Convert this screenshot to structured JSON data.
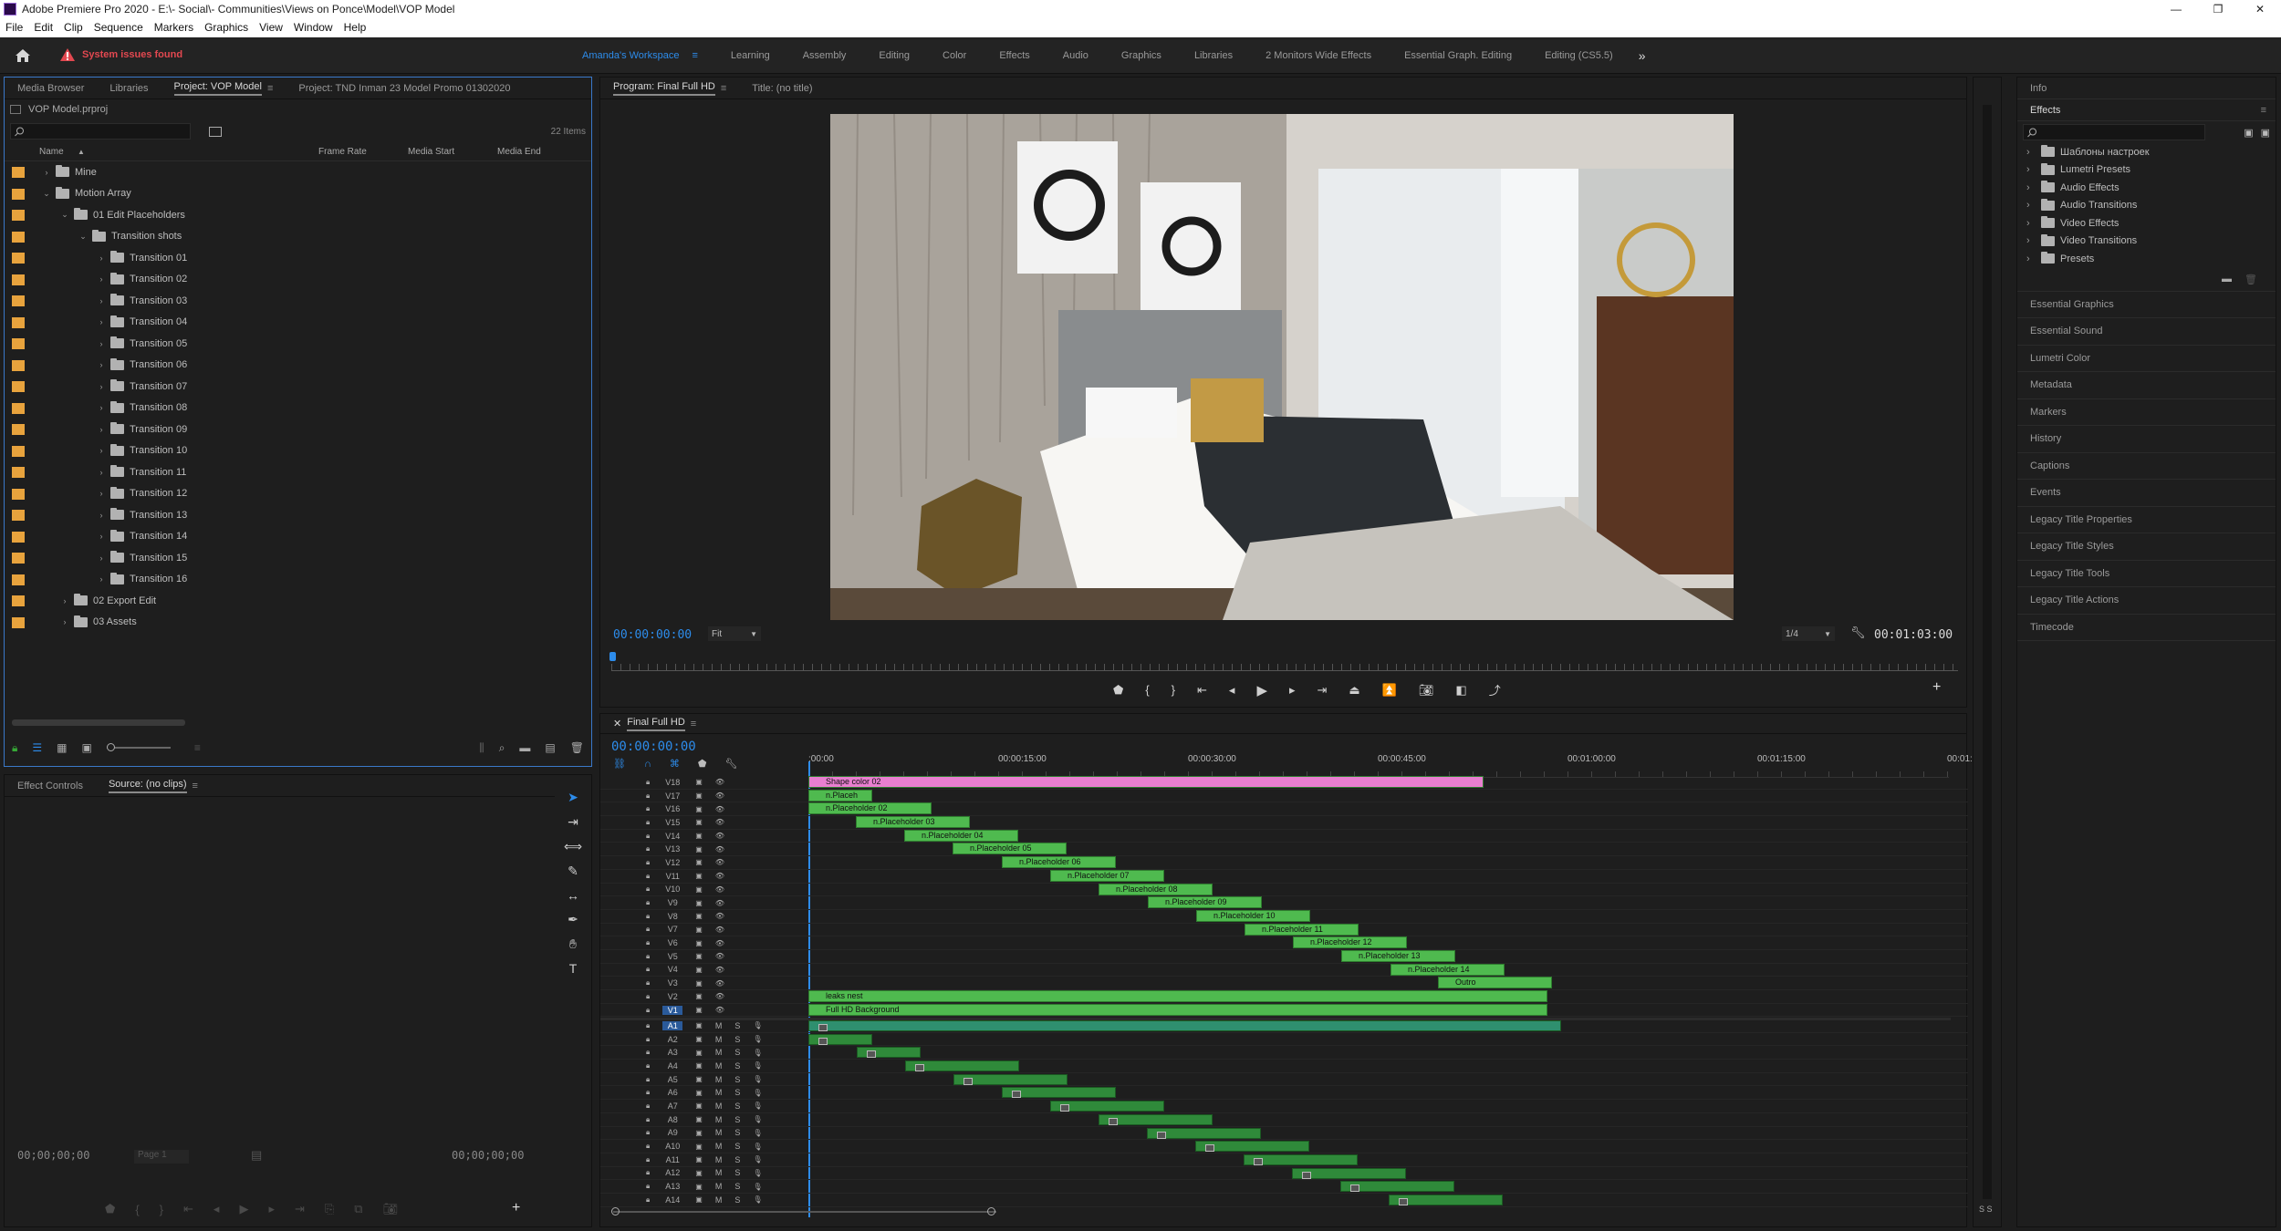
{
  "window": {
    "title": "Adobe Premiere Pro 2020 - E:\\- Social\\- Communities\\Views on Ponce\\Model\\VOP Model",
    "controls": [
      "—",
      "❐",
      "✕"
    ]
  },
  "menu": [
    "File",
    "Edit",
    "Clip",
    "Sequence",
    "Markers",
    "Graphics",
    "View",
    "Window",
    "Help"
  ],
  "workspace": {
    "alert": "System issues found",
    "tabs": [
      "Amanda's Workspace",
      "Learning",
      "Assembly",
      "Editing",
      "Color",
      "Effects",
      "Audio",
      "Graphics",
      "Libraries",
      "2 Monitors Wide Effects",
      "Essential Graph. Editing",
      "Editing (CS5.5)"
    ],
    "active": "Amanda's Workspace",
    "more": "»"
  },
  "project": {
    "tabs": [
      "Media Browser",
      "Libraries",
      "Project: VOP Model",
      "Project: TND Inman 23 Model Promo 01302020"
    ],
    "file": "VOP Model.prproj",
    "count": "22 Items",
    "columns": [
      "Name",
      "Frame Rate",
      "Media Start",
      "Media End"
    ],
    "rows": [
      {
        "label": "Mine",
        "indent": 0,
        "open": false
      },
      {
        "label": "Motion Array",
        "indent": 0,
        "open": true
      },
      {
        "label": "01 Edit Placeholders",
        "indent": 1,
        "open": true
      },
      {
        "label": "Transition shots",
        "indent": 2,
        "open": true
      },
      {
        "label": "Transition 01",
        "indent": 3,
        "open": false
      },
      {
        "label": "Transition 02",
        "indent": 3,
        "open": false
      },
      {
        "label": "Transition 03",
        "indent": 3,
        "open": false
      },
      {
        "label": "Transition 04",
        "indent": 3,
        "open": false
      },
      {
        "label": "Transition 05",
        "indent": 3,
        "open": false
      },
      {
        "label": "Transition 06",
        "indent": 3,
        "open": false
      },
      {
        "label": "Transition 07",
        "indent": 3,
        "open": false
      },
      {
        "label": "Transition 08",
        "indent": 3,
        "open": false
      },
      {
        "label": "Transition 09",
        "indent": 3,
        "open": false
      },
      {
        "label": "Transition 10",
        "indent": 3,
        "open": false
      },
      {
        "label": "Transition 11",
        "indent": 3,
        "open": false
      },
      {
        "label": "Transition 12",
        "indent": 3,
        "open": false
      },
      {
        "label": "Transition 13",
        "indent": 3,
        "open": false
      },
      {
        "label": "Transition 14",
        "indent": 3,
        "open": false
      },
      {
        "label": "Transition 15",
        "indent": 3,
        "open": false
      },
      {
        "label": "Transition 16",
        "indent": 3,
        "open": false
      },
      {
        "label": "02 Export Edit",
        "indent": 1,
        "open": false
      },
      {
        "label": "03 Assets",
        "indent": 1,
        "open": false
      }
    ]
  },
  "source": {
    "tabs": [
      "Effect Controls",
      "Source: (no clips)"
    ],
    "tc_left": "00;00;00;00",
    "tc_right": "00;00;00;00",
    "page": "Page 1"
  },
  "program": {
    "tabs": [
      "Program: Final Full HD",
      "Title: (no title)"
    ],
    "tc": "00:00:00:00",
    "fit": "Fit",
    "res": "1/4",
    "duration": "00:01:03:00"
  },
  "timeline": {
    "tab": "Final Full HD",
    "tc": "00:00:00:00",
    "ruler": [
      ":00:00",
      "00:00:15:00",
      "00:00:30:00",
      "00:00:45:00",
      "00:01:00:00",
      "00:01:15:00",
      "00:01:"
    ],
    "video_tracks": [
      "V18",
      "V17",
      "V16",
      "V15",
      "V14",
      "V13",
      "V12",
      "V11",
      "V10",
      "V9",
      "V8",
      "V7",
      "V6",
      "V5",
      "V4",
      "V3",
      "V2",
      "V1"
    ],
    "audio_tracks": [
      "A1",
      "A2",
      "A3",
      "A4",
      "A5",
      "A6",
      "A7",
      "A8",
      "A9",
      "A10",
      "A11",
      "A12",
      "A13",
      "A14"
    ],
    "clips": [
      {
        "label": "Shape color 02",
        "color": "#e97fd0"
      },
      {
        "label": "n.Placeh",
        "color": "#4fba4f"
      },
      {
        "label": "n.Placeholder 02",
        "color": "#4fba4f"
      },
      {
        "label": "n.Placeholder 03",
        "color": "#4fba4f"
      },
      {
        "label": "n.Placeholder 04",
        "color": "#4fba4f"
      },
      {
        "label": "n.Placeholder 05",
        "color": "#4fba4f"
      },
      {
        "label": "n.Placeholder 06",
        "color": "#4fba4f"
      },
      {
        "label": "n.Placeholder 07",
        "color": "#4fba4f"
      },
      {
        "label": "n.Placeholder 08",
        "color": "#4fba4f"
      },
      {
        "label": "n.Placeholder 09",
        "color": "#4fba4f"
      },
      {
        "label": "n.Placeholder 10",
        "color": "#4fba4f"
      },
      {
        "label": "n.Placeholder 11",
        "color": "#4fba4f"
      },
      {
        "label": "n.Placeholder 12",
        "color": "#4fba4f"
      },
      {
        "label": "n.Placeholder 13",
        "color": "#4fba4f"
      },
      {
        "label": "n.Placeholder 14",
        "color": "#4fba4f"
      },
      {
        "label": "Outro",
        "color": "#4fba4f"
      },
      {
        "label": "leaks nest",
        "color": "#4fba4f"
      },
      {
        "label": "Full HD Background",
        "color": "#4fba4f"
      }
    ]
  },
  "effects": {
    "info": "Info",
    "title": "Effects",
    "items": [
      "Шаблоны настроек",
      "Lumetri Presets",
      "Audio Effects",
      "Audio Transitions",
      "Video Effects",
      "Video Transitions",
      "Presets"
    ]
  },
  "side_panels": [
    "Essential Graphics",
    "Essential Sound",
    "Lumetri Color",
    "Metadata",
    "Markers",
    "History",
    "Captions",
    "Events",
    "Legacy Title Properties",
    "Legacy Title Styles",
    "Legacy Title Tools",
    "Legacy Title Actions",
    "Timecode"
  ],
  "meter": "S S",
  "colors": {
    "accent": "#2d8ceb",
    "label_orange": "#e8a33d",
    "clip_green": "#4fba4f",
    "clip_pink": "#e97fd0",
    "alert_red": "#e34850"
  }
}
